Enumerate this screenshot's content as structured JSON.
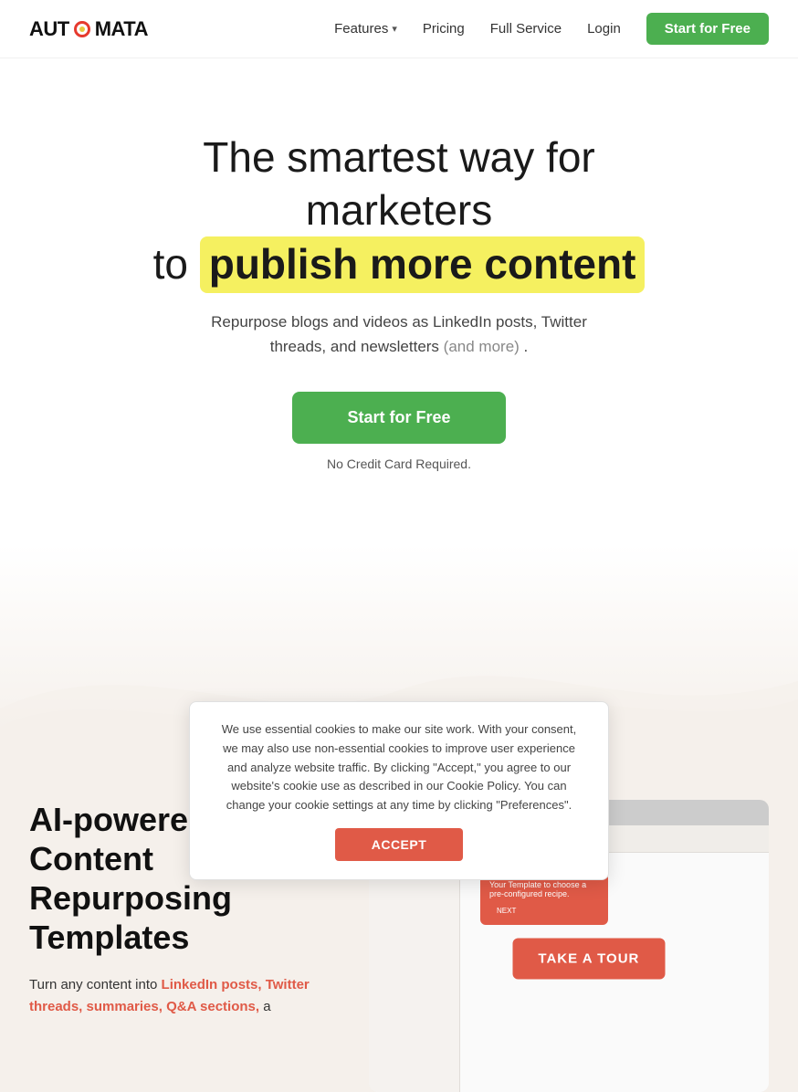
{
  "brand": {
    "name_before": "AUT",
    "name_after": "MATA"
  },
  "nav": {
    "features_label": "Features",
    "pricing_label": "Pricing",
    "full_service_label": "Full Service",
    "login_label": "Login",
    "cta_label": "Start for Free"
  },
  "hero": {
    "line1": "The smartest way for",
    "line2": "marketers",
    "line3_prefix": "to ",
    "line3_highlight": "publish more content",
    "subtitle_main": "Repurpose blogs and videos as LinkedIn posts, Twitter threads, and newsletters",
    "subtitle_suffix": "(and more)",
    "subtitle_end": ".",
    "cta_label": "Start for Free",
    "no_cc": "No Credit Card Required."
  },
  "features": {
    "title_line1": "AI-powered Content",
    "title_line2": "Repurposing",
    "title_line3": "Templates",
    "body_prefix": "Turn any content into ",
    "body_link": "LinkedIn posts, Twitter threads, summaries, Q&A sections,",
    "body_suffix": "a",
    "screenshot_label": "TAKE A TOUR"
  },
  "cookie": {
    "text": "We use essential cookies to make our site work. With your consent, we may also use non-essential cookies to improve user experience and analyze website traffic. By clicking \"Accept,\" you agree to our website's cookie use as described in our Cookie Policy. You can change your cookie settings at any time by clicking \"Preferences\".",
    "accept_label": "ACCEPT"
  }
}
